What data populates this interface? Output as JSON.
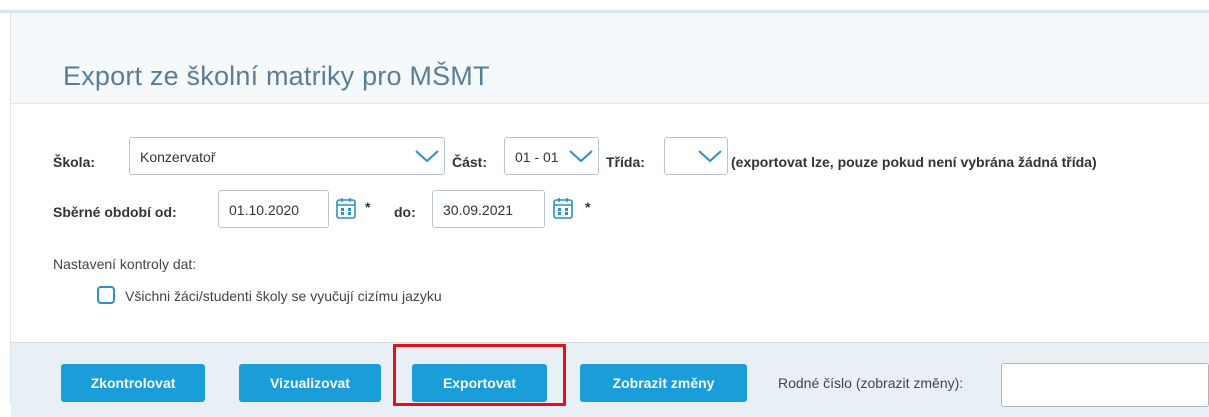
{
  "header": {
    "title": "Export ze školní matriky pro MŠMT"
  },
  "form": {
    "skola": {
      "label": "Škola:",
      "value": "Konzervatoř"
    },
    "cast": {
      "label": "Část:",
      "value": "01 - 01"
    },
    "trida": {
      "label": "Třída:",
      "value": "",
      "note": "(exportovat lze, pouze pokud není vybrána žádná třída)"
    },
    "obdobi": {
      "label_from": "Sběrné období od:",
      "from": "01.10.2020",
      "label_to": "do:",
      "to": "30.09.2021",
      "required_mark": "*"
    },
    "kontrola": {
      "heading": "Nastavení kontroly dat:",
      "checkbox_label": "Všichni žáci/studenti školy se vyučují cizímu jazyku",
      "checked": false
    }
  },
  "toolbar": {
    "check": "Zkontrolovat",
    "visualize": "Vizualizovat",
    "export": "Exportovat",
    "show_changes": "Zobrazit změny",
    "rc_label": "Rodné číslo (zobrazit změny):",
    "rc_value": ""
  },
  "colors": {
    "accent": "#1a9dd9",
    "title": "#5a7d96",
    "highlight": "#e0111b",
    "checkbox": "#2c8fc8"
  },
  "icons": [
    "chevron-down-icon",
    "calendar-icon"
  ]
}
